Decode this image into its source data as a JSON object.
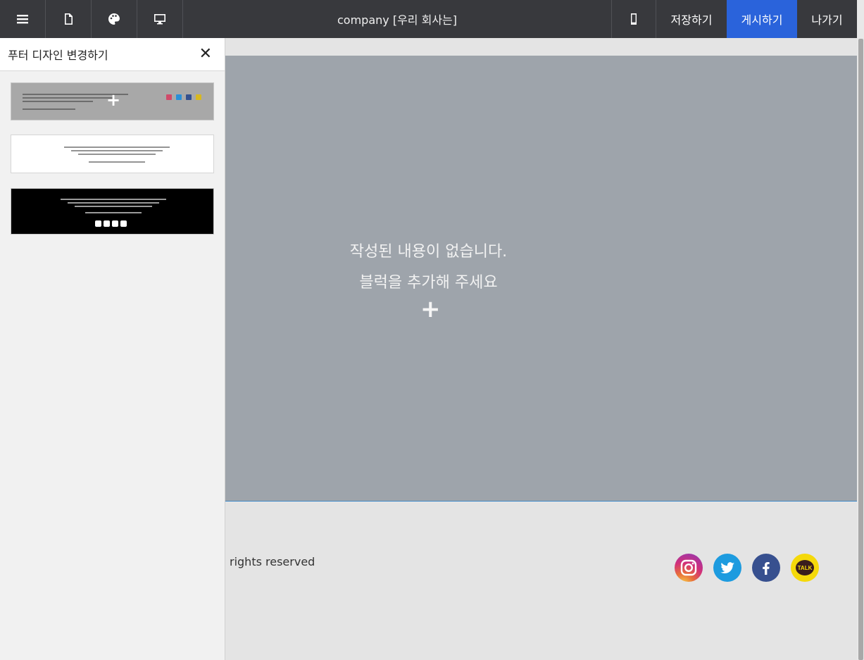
{
  "toolbar": {
    "menu_icon": "hamburger-icon",
    "page_icon": "page-icon",
    "palette_icon": "palette-icon",
    "desktop_icon": "desktop-icon",
    "title": "company [우리 회사는]",
    "mobile_icon": "mobile-icon",
    "save_label": "저장하기",
    "publish_label": "게시하기",
    "exit_label": "나가기",
    "publish_color": "#2a63db"
  },
  "panel": {
    "title": "푸터 디자인 변경하기",
    "close_label": "✕",
    "templates": [
      {
        "name": "gray-footer-template",
        "plus": "+"
      },
      {
        "name": "white-footer-template"
      },
      {
        "name": "black-footer-template"
      }
    ]
  },
  "main": {
    "empty_line1": "작성된 내용이 없습니다.",
    "empty_line2": "블럭을 추가해 주세요",
    "add_label": "+"
  },
  "footer": {
    "copyright": "rights reserved",
    "social": [
      {
        "name": "instagram-icon"
      },
      {
        "name": "twitter-icon"
      },
      {
        "name": "facebook-icon"
      },
      {
        "name": "kakaotalk-icon",
        "label": "TALK"
      }
    ]
  }
}
